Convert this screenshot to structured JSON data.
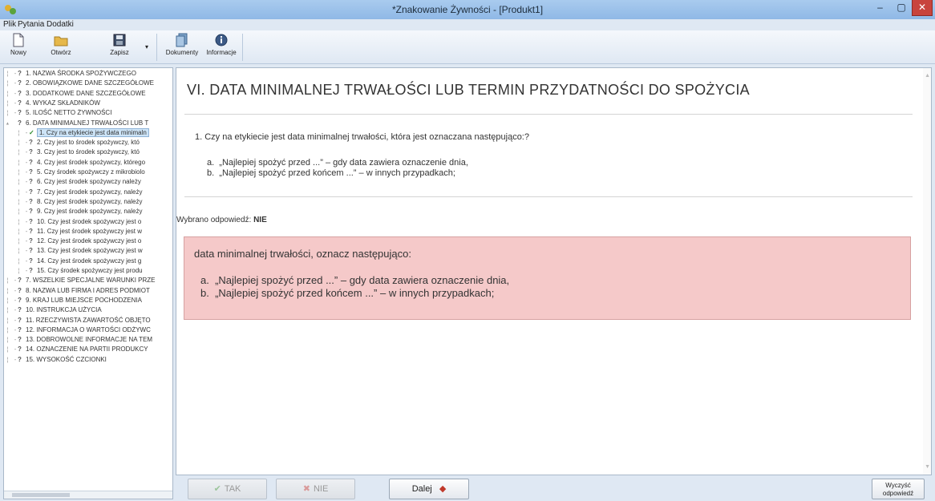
{
  "window": {
    "title": "*Znakowanie Żywności - [Produkt1]",
    "minimize": "–",
    "maximize": "▢",
    "close": "✕"
  },
  "menu": [
    "Plik",
    "Pytania",
    "Dodatki"
  ],
  "toolbar": {
    "new": "Nowy",
    "open": "Otwórz",
    "save": "Zapisz",
    "dropdown": "▾",
    "documents": "Dokumenty",
    "info": "Informacje"
  },
  "tree": [
    {
      "qm": "?",
      "label": "1. NAZWA ŚRODKA SPOŻYWCZEGO",
      "indent": 0
    },
    {
      "qm": "?",
      "label": "2. OBOWIĄZKOWE DANE SZCZEGÓŁOWE",
      "indent": 0
    },
    {
      "qm": "?",
      "label": "3. DODATKOWE DANE SZCZEGÓŁOWE",
      "indent": 0
    },
    {
      "qm": "?",
      "label": "4. WYKAZ SKŁADNIKÓW",
      "indent": 0
    },
    {
      "qm": "?",
      "label": "5. ILOŚĆ NETTO ŻYWNOŚCI",
      "indent": 0
    },
    {
      "qm": "?",
      "label": "6. DATA MINIMALNEJ TRWAŁOŚCI LUB T",
      "indent": 0,
      "expanded": true
    },
    {
      "qm": "✓",
      "label": "1. Czy na etykiecie jest data minimaln",
      "indent": 1,
      "selected": true
    },
    {
      "qm": "?",
      "label": "2. Czy jest to środek spożywczy, któ",
      "indent": 1
    },
    {
      "qm": "?",
      "label": "3. Czy jest to środek spożywczy, któ",
      "indent": 1
    },
    {
      "qm": "?",
      "label": "4. Czy jest środek spożywczy, którego",
      "indent": 1
    },
    {
      "qm": "?",
      "label": "5. Czy środek spożywczy z mikrobiolo",
      "indent": 1
    },
    {
      "qm": "?",
      "label": "6. Czy jest środek spożywczy należy",
      "indent": 1
    },
    {
      "qm": "?",
      "label": "7. Czy jest środek spożywczy, należy",
      "indent": 1
    },
    {
      "qm": "?",
      "label": "8. Czy jest środek spożywczy, należy",
      "indent": 1
    },
    {
      "qm": "?",
      "label": "9. Czy jest środek spożywczy, należy",
      "indent": 1
    },
    {
      "qm": "?",
      "label": "10. Czy jest środek spożywczy jest o",
      "indent": 1
    },
    {
      "qm": "?",
      "label": "11. Czy jest środek spożywczy jest w",
      "indent": 1
    },
    {
      "qm": "?",
      "label": "12. Czy jest środek spożywczy jest o",
      "indent": 1
    },
    {
      "qm": "?",
      "label": "13. Czy jest środek spożywczy jest w",
      "indent": 1
    },
    {
      "qm": "?",
      "label": "14. Czy jest środek spożywczy jest g",
      "indent": 1
    },
    {
      "qm": "?",
      "label": "15. Czy środek spożywczy jest produ",
      "indent": 1
    },
    {
      "qm": "?",
      "label": "7. WSZELKIE SPECJALNE WARUNKI PRZE",
      "indent": 0
    },
    {
      "qm": "?",
      "label": "8. NAZWA LUB FIRMA I ADRES PODMIOT",
      "indent": 0
    },
    {
      "qm": "?",
      "label": "9. KRAJ LUB MIEJSCE POCHODZENIA",
      "indent": 0
    },
    {
      "qm": "?",
      "label": "10. INSTRUKCJA UŻYCIA",
      "indent": 0
    },
    {
      "qm": "?",
      "label": "11. RZECZYWISTA ZAWARTOŚĆ OBJĘTO",
      "indent": 0
    },
    {
      "qm": "?",
      "label": "12. INFORMACJA O WARTOŚCI ODŻYWC",
      "indent": 0
    },
    {
      "qm": "?",
      "label": "13. DOBROWOLNE INFORMACJE NA TEM",
      "indent": 0
    },
    {
      "qm": "?",
      "label": "14. OZNACZENIE NA PARTII PRODUKCY",
      "indent": 0
    },
    {
      "qm": "?",
      "label": "15. WYSOKOŚĆ CZCIONKI",
      "indent": 0
    }
  ],
  "content": {
    "section_title": "VI. DATA MINIMALNEJ TRWAŁOŚCI LUB TERMIN PRZYDATNOŚCI DO SPOŻYCIA",
    "question": "1.  Czy na etykiecie jest data minimalnej trwałości, która jest oznaczana następująco:?",
    "question_options": [
      "a.  „Najlepiej spożyć przed ...” – gdy data zawiera oznaczenie dnia,",
      "b.  „Najlepiej spożyć przed końcem ...” – w innych przypadkach;"
    ],
    "answer_label": "Wybrano odpowiedź: ",
    "answer_value": "NIE",
    "alert_title": "data minimalnej trwałości, oznacz następująco:",
    "alert_options": [
      "a.  „Najlepiej spożyć przed ...” – gdy data zawiera oznaczenie dnia,",
      "b.  „Najlepiej spożyć przed końcem ...” – w innych przypadkach;"
    ]
  },
  "bottom": {
    "yes": "TAK",
    "no": "NIE",
    "next": "Dalej",
    "reset_line1": "Wyczyść",
    "reset_line2": "odpowiedź"
  },
  "colors": {
    "alert_bg": "#f5c9c9",
    "close_btn": "#c8443d",
    "selected_bg": "#cde4f7"
  }
}
